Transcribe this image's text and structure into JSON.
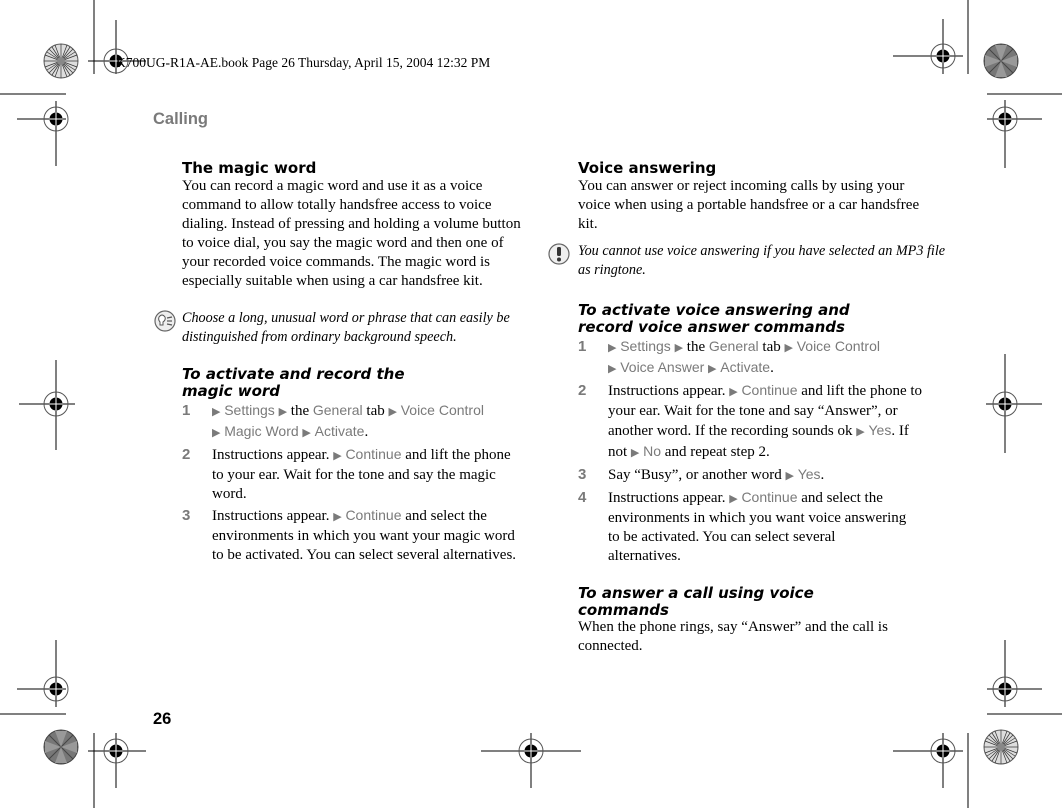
{
  "header": {
    "file_info": "K700UG-R1A-AE.book  Page 26  Thursday, April 15, 2004  12:32 PM",
    "section": "Calling"
  },
  "footer": {
    "page_number": "26"
  },
  "colors": {
    "menu_gray": "#7a7a7a",
    "text": "#000000"
  },
  "left": {
    "title": "The magic word",
    "paragraph": "You can record a magic word and use it as a voice command to allow totally handsfree access to voice dialing. Instead of pressing and holding a volume button to voice dial, you say the magic word and then one of your recorded voice commands. The magic word is especially suitable when using a car handsfree kit.",
    "tip_icon": "tip-lightbulb-icon",
    "tip": "Choose a long, unusual word or phrase that can easily be distinguished from ordinary background speech.",
    "procedure_title": "To activate and record the magic word",
    "steps": [
      {
        "num": "1",
        "items": [
          "Settings",
          "the",
          "General",
          "tab",
          "Voice Control",
          "Magic Word",
          "Activate",
          "."
        ]
      },
      {
        "num": "2",
        "pre": "Instructions appear.",
        "menu": "Continue",
        "post": "and lift the phone to your ear. Wait for the tone and say the magic word."
      },
      {
        "num": "3",
        "pre": "Instructions appear.",
        "menu": "Continue",
        "post": "and select the environments in which you want your magic word to be activated. You can select several alternatives."
      }
    ]
  },
  "right": {
    "title": "Voice answering",
    "paragraph": "You can answer or reject incoming calls by using your voice when using a portable handsfree or a car handsfree kit.",
    "warning_icon": "exclamation-icon",
    "warning": "You cannot use voice answering if you have selected an MP3 file as ringtone.",
    "procedure_title": "To activate voice answering and record voice answer commands",
    "steps": [
      {
        "num": "1",
        "items": [
          "Settings",
          "the",
          "General",
          "tab",
          "Voice Control",
          "Voice Answer",
          "Activate",
          "."
        ]
      },
      {
        "num": "2",
        "pre": "Instructions appear.",
        "menu": "Continue",
        "mid": "and lift the phone to your ear. Wait for the tone and say “Answer”, or another word. If the recording sounds ok",
        "yes": "Yes",
        "mid2": ". If not",
        "no": "No",
        "post": "and repeat step 2."
      },
      {
        "num": "3",
        "pre": "Say “Busy”, or another word",
        "menu": "Yes",
        "post": "."
      },
      {
        "num": "4",
        "pre": "Instructions appear.",
        "menu": "Continue",
        "post": "and select the environments in which you want voice answering to be activated. You can select several alternatives."
      }
    ],
    "procedure2_title": "To answer a call using voice commands",
    "procedure2_text": "When the phone rings, say “Answer” and the call is connected."
  }
}
